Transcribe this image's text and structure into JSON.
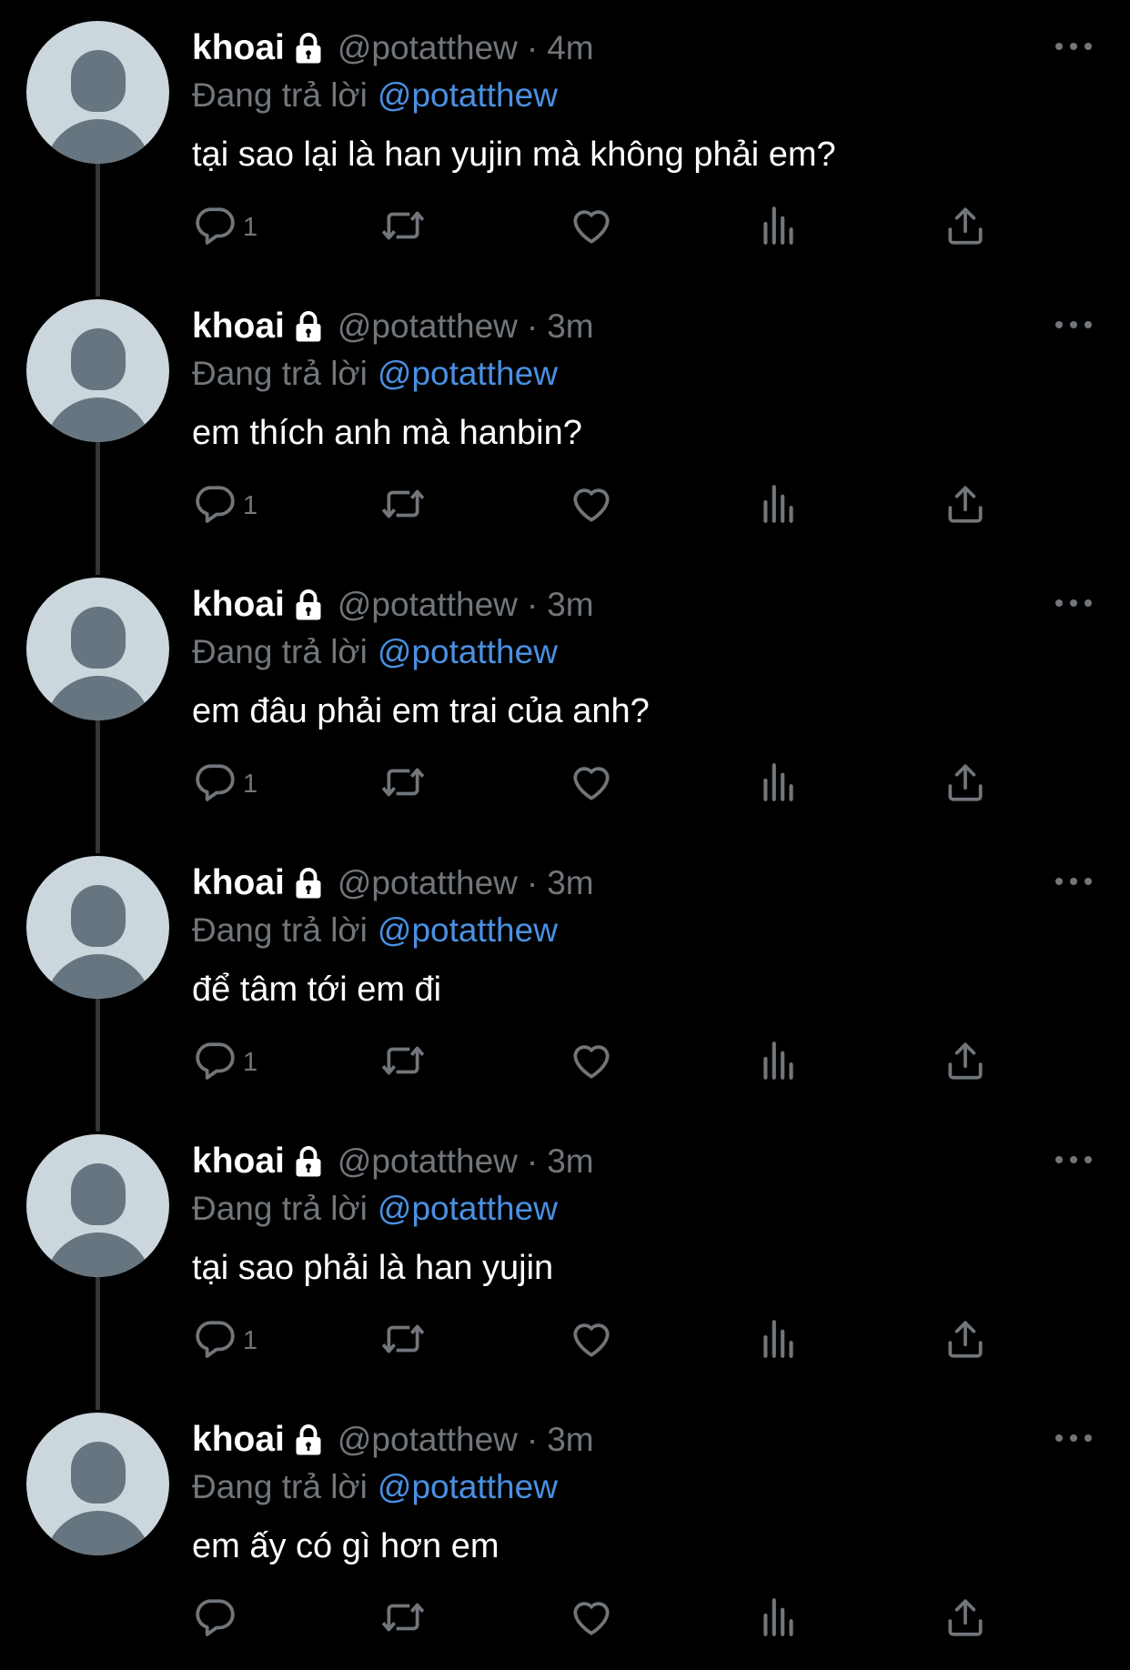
{
  "thread": {
    "tweets": [
      {
        "name": "khoai",
        "handle": "@potatthew",
        "separator": "·",
        "time": "4m",
        "reply_prefix": "Đang trả lời",
        "reply_to": "@potatthew",
        "text": "tại sao lại là han yujin mà không phải em?",
        "reply_count": "1"
      },
      {
        "name": "khoai",
        "handle": "@potatthew",
        "separator": "·",
        "time": "3m",
        "reply_prefix": "Đang trả lời",
        "reply_to": "@potatthew",
        "text": "em thích anh mà hanbin?",
        "reply_count": "1"
      },
      {
        "name": "khoai",
        "handle": "@potatthew",
        "separator": "·",
        "time": "3m",
        "reply_prefix": "Đang trả lời",
        "reply_to": "@potatthew",
        "text": "em đâu phải em trai của anh?",
        "reply_count": "1"
      },
      {
        "name": "khoai",
        "handle": "@potatthew",
        "separator": "·",
        "time": "3m",
        "reply_prefix": "Đang trả lời",
        "reply_to": "@potatthew",
        "text": "để tâm tới em đi",
        "reply_count": "1"
      },
      {
        "name": "khoai",
        "handle": "@potatthew",
        "separator": "·",
        "time": "3m",
        "reply_prefix": "Đang trả lời",
        "reply_to": "@potatthew",
        "text": "tại sao phải là han yujin",
        "reply_count": "1"
      },
      {
        "name": "khoai",
        "handle": "@potatthew",
        "separator": "·",
        "time": "3m",
        "reply_prefix": "Đang trả lời",
        "reply_to": "@potatthew",
        "text": "em ấy có gì hơn em",
        "reply_count": ""
      }
    ]
  },
  "icons": {
    "lock": "lock-icon",
    "more": "more-icon",
    "reply": "reply-icon",
    "retweet": "retweet-icon",
    "like": "heart-icon",
    "views": "views-icon",
    "share": "share-icon"
  },
  "colors": {
    "background": "#000000",
    "primary_text": "#ffffff",
    "secondary_text": "#71767b",
    "mention": "#4a90e2",
    "thread_line": "#333639",
    "avatar_bg": "#ccd6dd",
    "avatar_fg": "#66757f"
  }
}
